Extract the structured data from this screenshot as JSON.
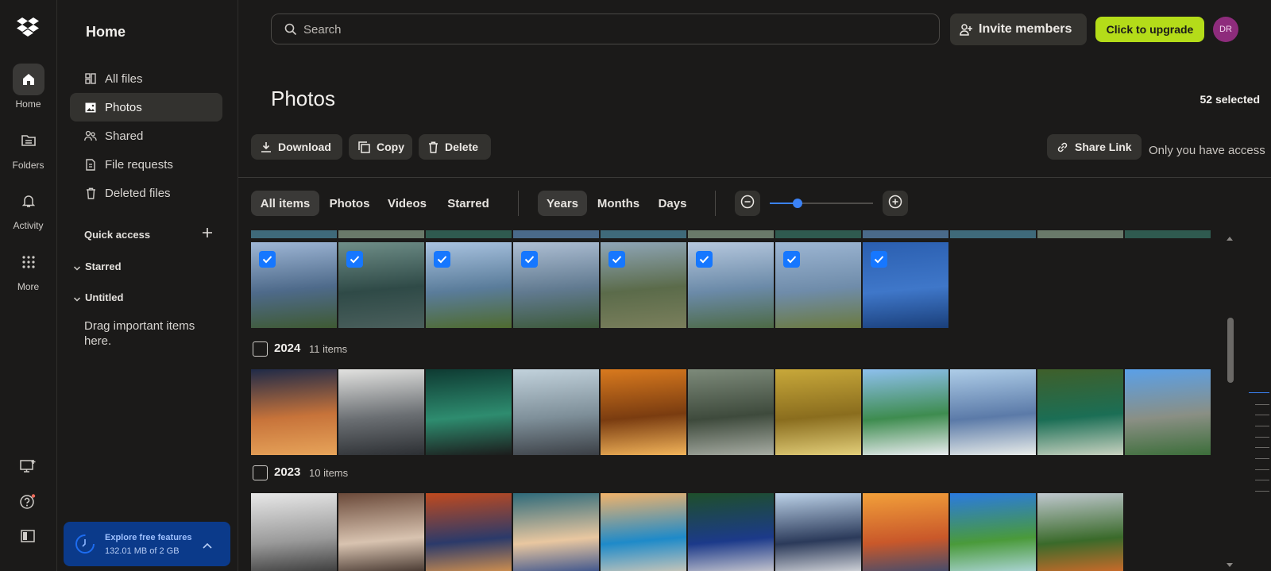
{
  "rail": {
    "items": [
      {
        "label": "Home",
        "icon": "home-icon",
        "active": true
      },
      {
        "label": "Folders",
        "icon": "folder-icon"
      },
      {
        "label": "Activity",
        "icon": "bell-icon"
      },
      {
        "label": "More",
        "icon": "grid-icon"
      }
    ],
    "bottom_icons": [
      "desktop-app-icon",
      "help-icon",
      "sidebar-toggle-icon"
    ]
  },
  "nav": {
    "title": "Home",
    "items": [
      {
        "label": "All files",
        "icon": "all-files-icon"
      },
      {
        "label": "Photos",
        "icon": "photos-icon",
        "active": true
      },
      {
        "label": "Shared",
        "icon": "shared-icon"
      },
      {
        "label": "File requests",
        "icon": "file-request-icon"
      },
      {
        "label": "Deleted files",
        "icon": "trash-icon"
      }
    ],
    "quick_access": "Quick access",
    "starred": "Starred",
    "untitled": "Untitled",
    "drag_hint": "Drag important items here.",
    "promo": {
      "title": "Explore free features",
      "usage": "132.01 MB of 2 GB"
    }
  },
  "header": {
    "search_placeholder": "Search",
    "invite_label": "Invite members",
    "upgrade_label": "Click to upgrade",
    "avatar_initials": "DR"
  },
  "page": {
    "title": "Photos",
    "selected": "52 selected",
    "actions": {
      "download": "Download",
      "copy": "Copy",
      "delete": "Delete",
      "share": "Share Link"
    },
    "access_note": "Only you have access"
  },
  "filters": {
    "types": [
      "All items",
      "Photos",
      "Videos",
      "Starred"
    ],
    "active_type": "All items",
    "granularity": [
      "Years",
      "Months",
      "Days"
    ],
    "active_granularity": "Years",
    "zoom_level": 0.27
  },
  "groups": [
    {
      "year": "2024",
      "count": "11 items",
      "tiles": 11
    },
    {
      "year": "2023",
      "count": "10 items",
      "tiles": 10
    }
  ],
  "selected_row_tiles": 8,
  "colors": {
    "accent": "#1677ff",
    "upgrade": "#b4dc19",
    "promo": "#0b3a8a"
  }
}
